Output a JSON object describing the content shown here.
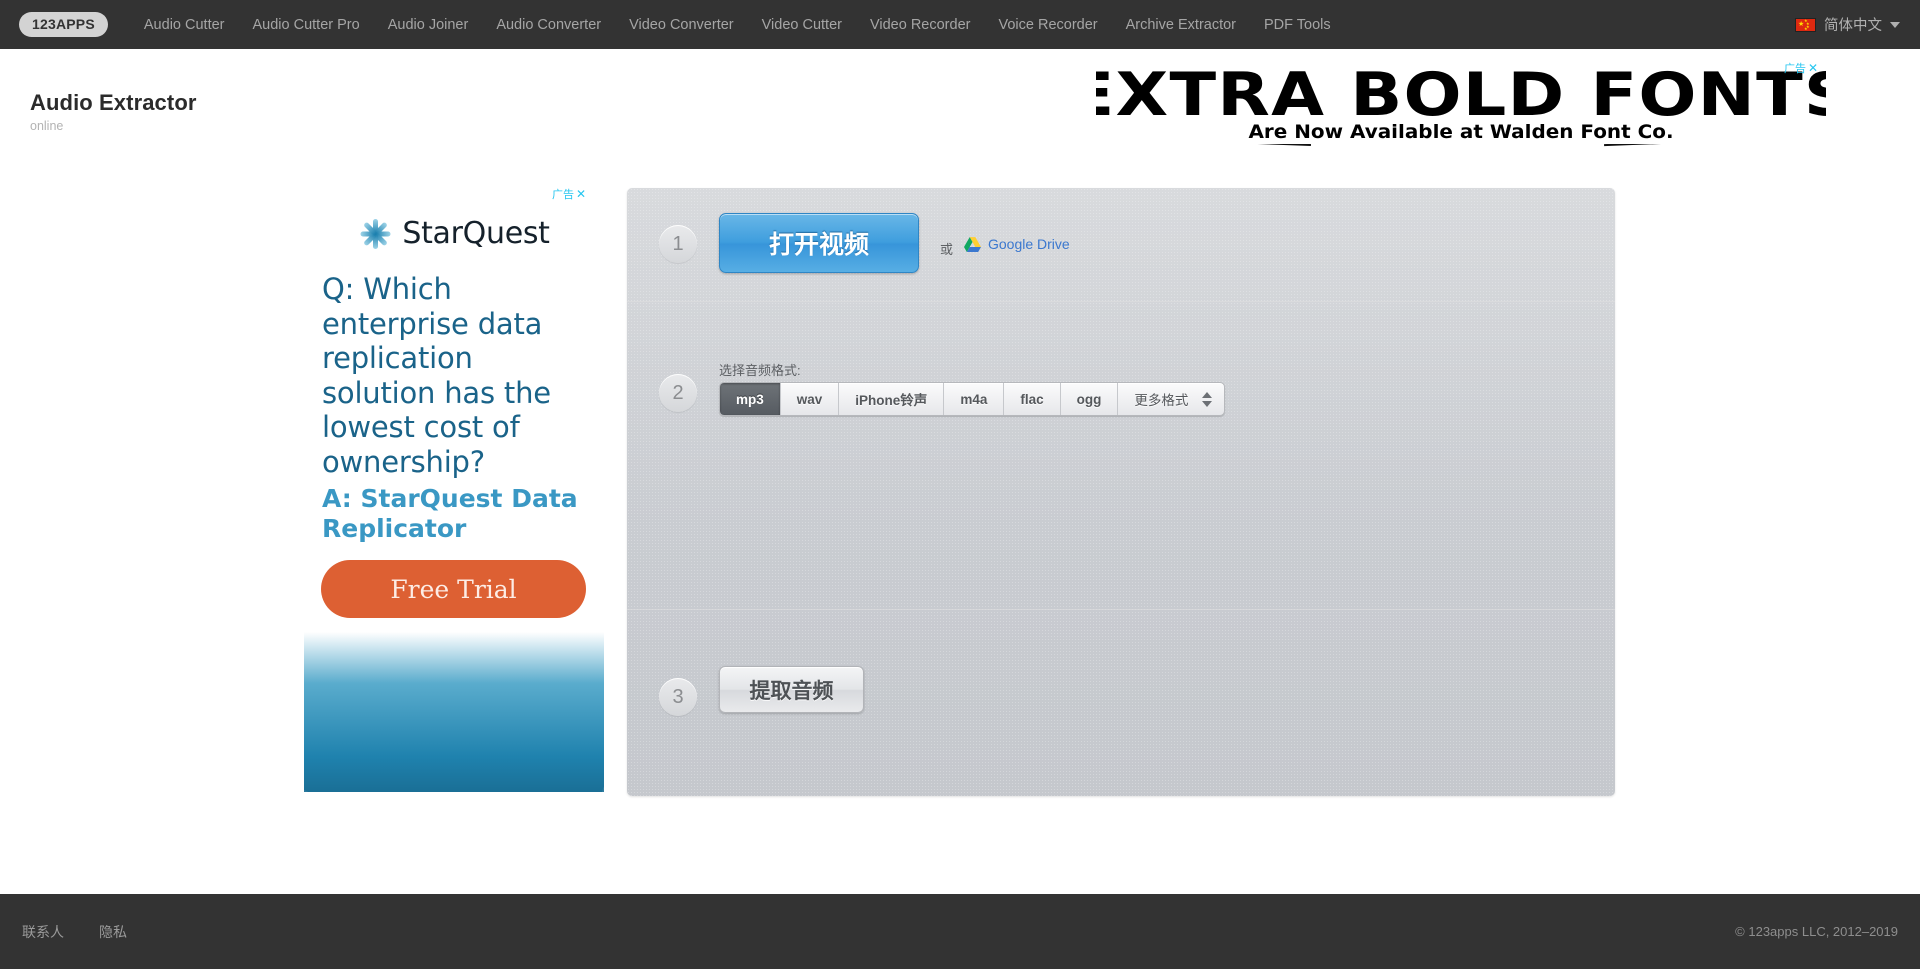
{
  "nav": {
    "logo": "123APPS",
    "items": [
      {
        "label": "Audio Cutter"
      },
      {
        "label": "Audio Cutter Pro"
      },
      {
        "label": "Audio Joiner"
      },
      {
        "label": "Audio Converter"
      },
      {
        "label": "Video Converter"
      },
      {
        "label": "Video Cutter"
      },
      {
        "label": "Video Recorder"
      },
      {
        "label": "Voice Recorder"
      },
      {
        "label": "Archive Extractor"
      },
      {
        "label": "PDF Tools"
      }
    ],
    "language": {
      "label": "简体中文",
      "flag": "cn-flag-icon",
      "caret": "chevron-down-icon"
    }
  },
  "header": {
    "title": "Audio Extractor",
    "subtitle": "online"
  },
  "banner_ad": {
    "line1": "EXTRA BOLD FONTS",
    "line2": "Are Now Available at Walden Font Co.",
    "close_label": "广告",
    "close_x": "✕"
  },
  "side_ad": {
    "close_label": "广告",
    "close_x": "✕",
    "brand": "StarQuest",
    "question": "Q: Which enterprise data replication solution has the lowest cost of ownership?",
    "answer_lead": "A: ",
    "answer": "StarQuest Data Replicator",
    "cta": "Free Trial",
    "cta_color": "#dd6033",
    "brand_color": "#1a6389"
  },
  "main": {
    "step1": {
      "number": "1",
      "open_button": "打开视频",
      "or": "或",
      "gdrive": "Google Drive"
    },
    "step2": {
      "number": "2",
      "label": "选择音频格式:",
      "formats": [
        {
          "label": "mp3",
          "selected": true
        },
        {
          "label": "wav",
          "selected": false
        },
        {
          "label": "iPhone铃声",
          "selected": false
        },
        {
          "label": "m4a",
          "selected": false
        },
        {
          "label": "flac",
          "selected": false
        },
        {
          "label": "ogg",
          "selected": false
        }
      ],
      "more_formats": "更多格式"
    },
    "step3": {
      "number": "3",
      "extract_button": "提取音频"
    }
  },
  "footer": {
    "links": [
      {
        "label": "联系人"
      },
      {
        "label": "隐私"
      }
    ],
    "copyright": "© 123apps LLC, 2012–2019"
  }
}
